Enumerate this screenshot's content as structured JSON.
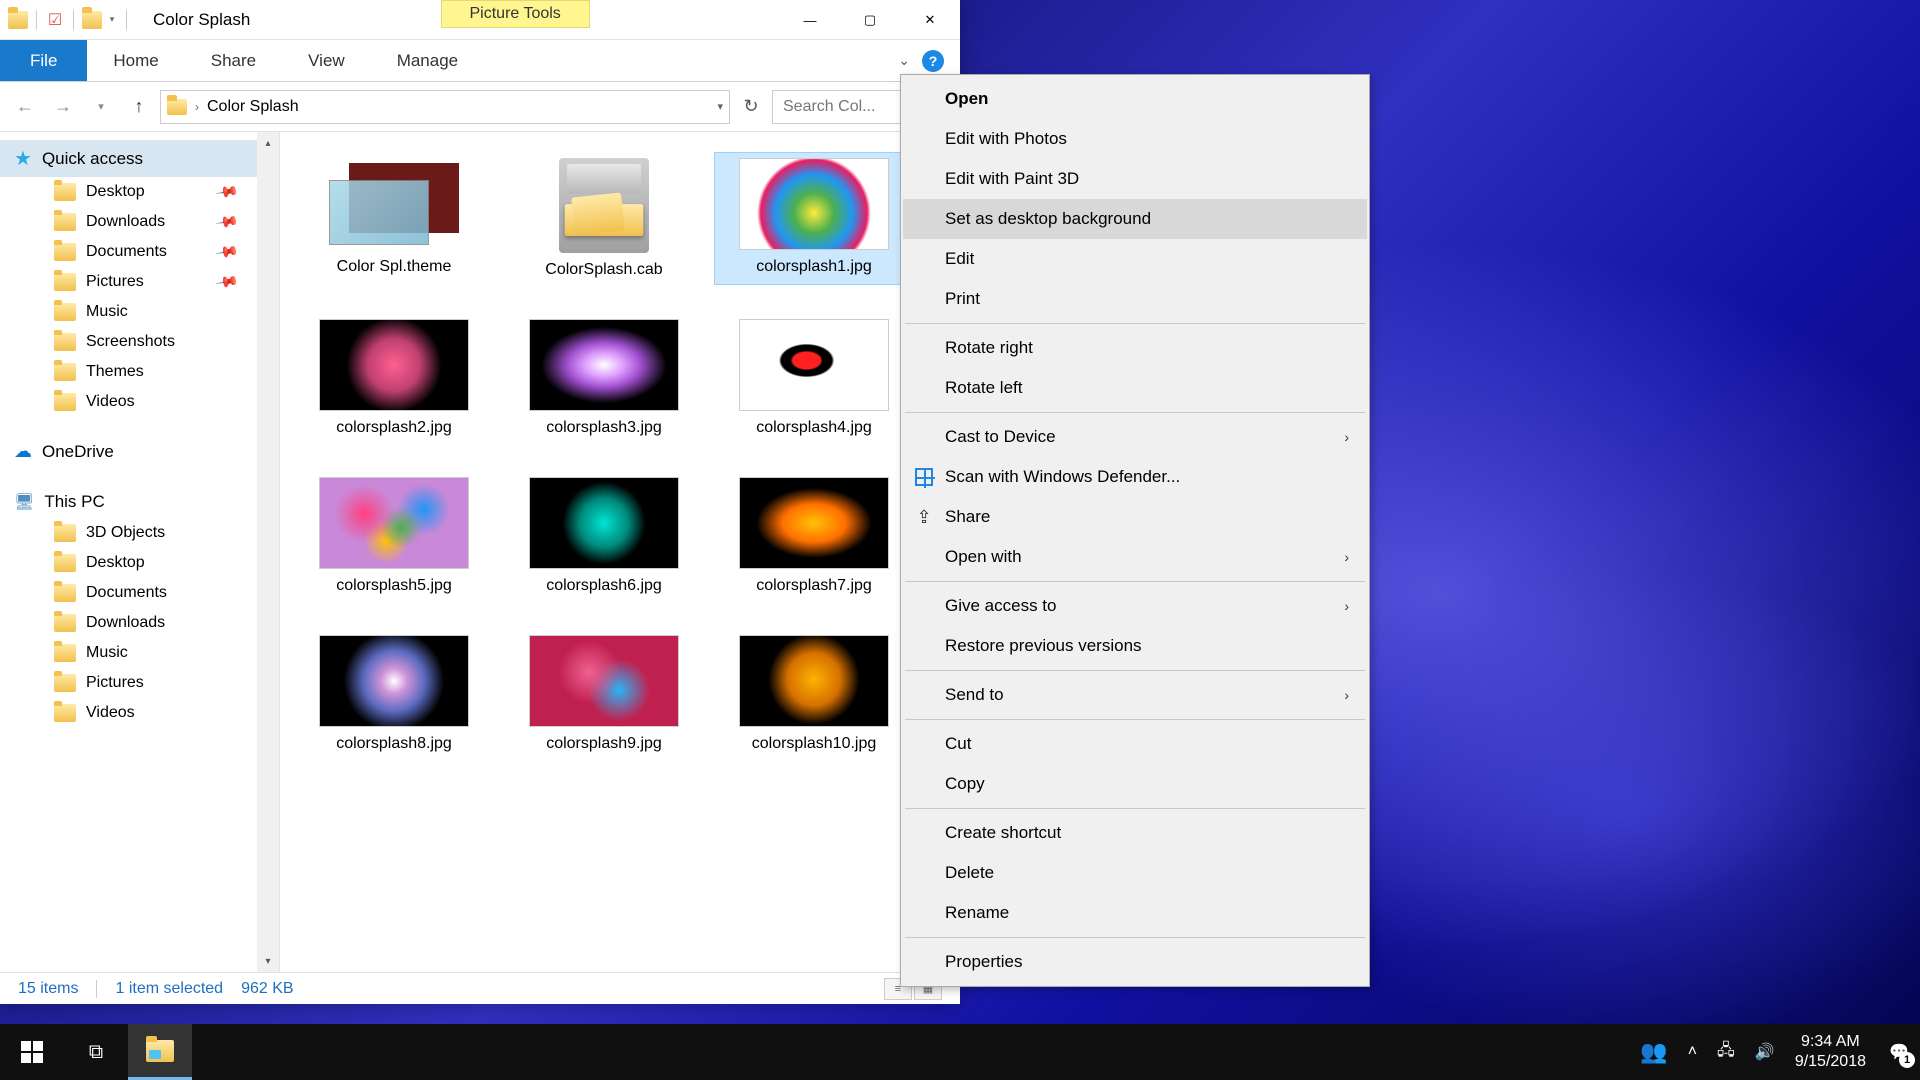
{
  "window": {
    "title": "Color Splash",
    "tools_tab": "Picture Tools",
    "controls": {
      "min": "—",
      "max": "▢",
      "close": "✕"
    }
  },
  "ribbon": {
    "file": "File",
    "tabs": [
      "Home",
      "Share",
      "View",
      "Manage"
    ]
  },
  "address": {
    "crumb": "Color Splash",
    "search_placeholder": "Search Col..."
  },
  "sidebar": {
    "quick_access": "Quick access",
    "quick_items": [
      {
        "label": "Desktop",
        "pinned": true
      },
      {
        "label": "Downloads",
        "pinned": true
      },
      {
        "label": "Documents",
        "pinned": true
      },
      {
        "label": "Pictures",
        "pinned": true
      },
      {
        "label": "Music",
        "pinned": false
      },
      {
        "label": "Screenshots",
        "pinned": false
      },
      {
        "label": "Themes",
        "pinned": false
      },
      {
        "label": "Videos",
        "pinned": false
      }
    ],
    "onedrive": "OneDrive",
    "this_pc": "This PC",
    "pc_items": [
      "3D Objects",
      "Desktop",
      "Documents",
      "Downloads",
      "Music",
      "Pictures",
      "Videos"
    ]
  },
  "files": [
    {
      "label": "Color Spl.theme",
      "kind": "theme"
    },
    {
      "label": "ColorSplash.cab",
      "kind": "cab"
    },
    {
      "label": "colorsplash1.jpg",
      "kind": "img",
      "cls": "splash1",
      "selected": true,
      "light": true
    },
    {
      "label": "colorsplash2.jpg",
      "kind": "img",
      "cls": "splash2"
    },
    {
      "label": "colorsplash3.jpg",
      "kind": "img",
      "cls": "splash3"
    },
    {
      "label": "colorsplash4.jpg",
      "kind": "img",
      "cls": "splash4",
      "light": true
    },
    {
      "label": "colorsplash5.jpg",
      "kind": "img",
      "cls": "splash5"
    },
    {
      "label": "colorsplash6.jpg",
      "kind": "img",
      "cls": "splash6"
    },
    {
      "label": "colorsplash7.jpg",
      "kind": "img",
      "cls": "splash7"
    },
    {
      "label": "colorsplash8.jpg",
      "kind": "img",
      "cls": "splash8"
    },
    {
      "label": "colorsplash9.jpg",
      "kind": "img",
      "cls": "splash9"
    },
    {
      "label": "colorsplash10.jpg",
      "kind": "img",
      "cls": "splash10"
    }
  ],
  "status": {
    "count": "15 items",
    "selection": "1 item selected",
    "size": "962 KB"
  },
  "context_menu": [
    {
      "label": "Open",
      "bold": true
    },
    {
      "label": "Edit with Photos"
    },
    {
      "label": "Edit with Paint 3D"
    },
    {
      "label": "Set as desktop background",
      "hovered": true
    },
    {
      "label": "Edit"
    },
    {
      "label": "Print"
    },
    {
      "sep": true
    },
    {
      "label": "Rotate right"
    },
    {
      "label": "Rotate left"
    },
    {
      "sep": true
    },
    {
      "label": "Cast to Device",
      "submenu": true
    },
    {
      "label": "Scan with Windows Defender...",
      "icon": "defender"
    },
    {
      "label": "Share",
      "icon": "share"
    },
    {
      "label": "Open with",
      "submenu": true
    },
    {
      "sep": true
    },
    {
      "label": "Give access to",
      "submenu": true
    },
    {
      "label": "Restore previous versions"
    },
    {
      "sep": true
    },
    {
      "label": "Send to",
      "submenu": true
    },
    {
      "sep": true
    },
    {
      "label": "Cut"
    },
    {
      "label": "Copy"
    },
    {
      "sep": true
    },
    {
      "label": "Create shortcut"
    },
    {
      "label": "Delete"
    },
    {
      "label": "Rename"
    },
    {
      "sep": true
    },
    {
      "label": "Properties"
    }
  ],
  "taskbar": {
    "time": "9:34 AM",
    "date": "9/15/2018",
    "notif_count": "1"
  }
}
